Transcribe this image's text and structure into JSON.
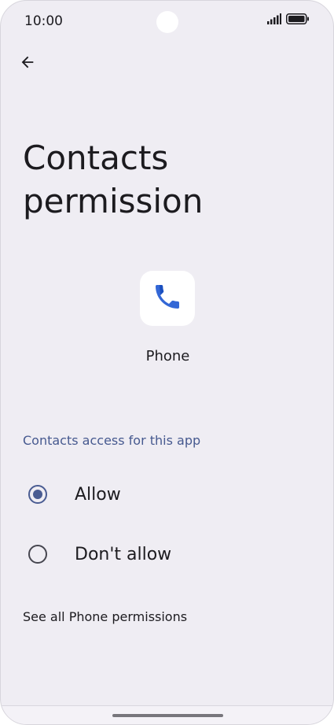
{
  "status_bar": {
    "time": "10:00",
    "icons": [
      "signal-icon",
      "battery-icon"
    ]
  },
  "header": {
    "back_icon": "arrow-back-icon"
  },
  "page": {
    "title": "Contacts permission"
  },
  "app": {
    "name": "Phone",
    "icon": "phone-icon",
    "icon_color": "#3367d6"
  },
  "permission": {
    "section_header": "Contacts access for this app",
    "options": [
      {
        "label": "Allow",
        "selected": true
      },
      {
        "label": "Don't allow",
        "selected": false
      }
    ],
    "see_all_link": "See all Phone permissions"
  },
  "colors": {
    "accent": "#4a5c92",
    "section_header": "#46598f",
    "background": "#efedf3"
  }
}
